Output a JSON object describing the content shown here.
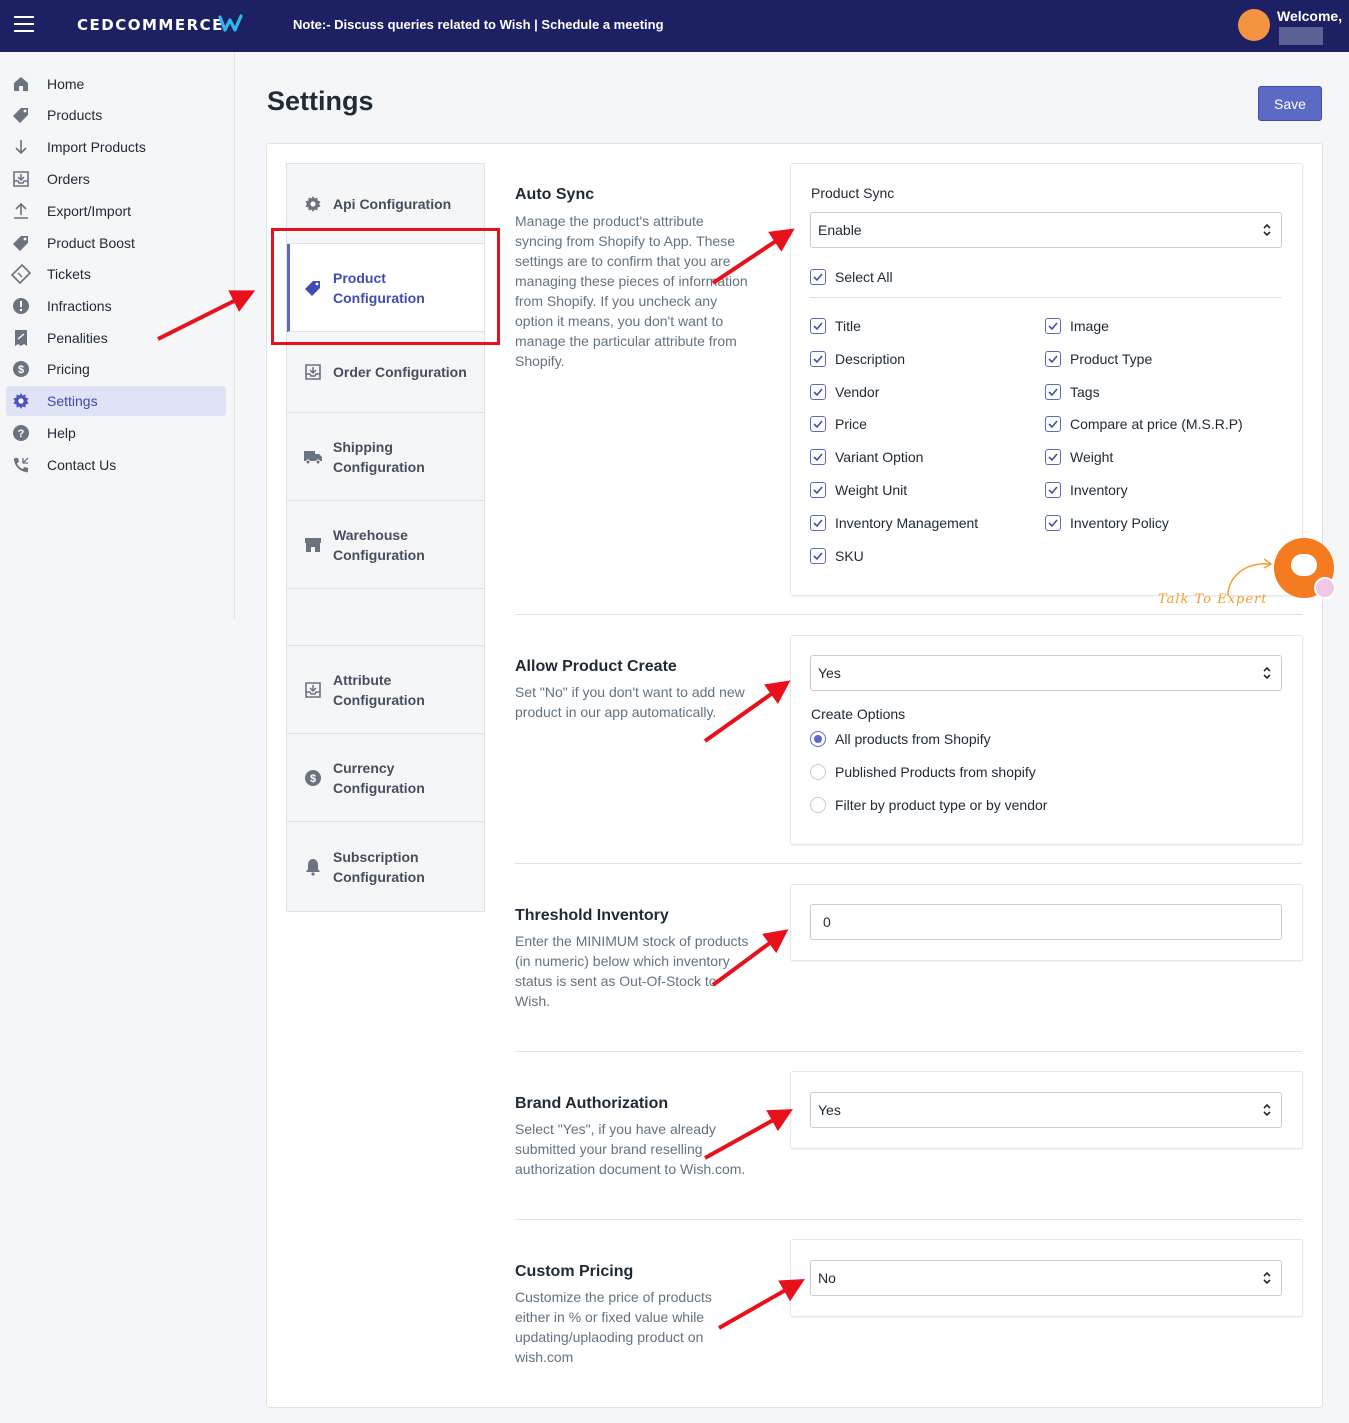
{
  "header": {
    "logo_text": "CEDCOMMERCE",
    "note_prefix": "Note:- Discuss queries related to Wish | ",
    "note_link": "Schedule a meeting",
    "welcome": "Welcome,"
  },
  "sidebar": {
    "items": [
      {
        "label": "Home",
        "icon": "home-icon"
      },
      {
        "label": "Products",
        "icon": "tag-icon"
      },
      {
        "label": "Import Products",
        "icon": "arrow-down-icon"
      },
      {
        "label": "Orders",
        "icon": "inbox-download-icon"
      },
      {
        "label": "Export/Import",
        "icon": "upload-icon"
      },
      {
        "label": "Product Boost",
        "icon": "tag-icon"
      },
      {
        "label": "Tickets",
        "icon": "ticket-icon"
      },
      {
        "label": "Infractions",
        "icon": "alert-icon"
      },
      {
        "label": "Penalities",
        "icon": "receipt-icon"
      },
      {
        "label": "Pricing",
        "icon": "dollar-icon"
      },
      {
        "label": "Settings",
        "icon": "gear-icon"
      },
      {
        "label": "Help",
        "icon": "question-icon"
      },
      {
        "label": "Contact Us",
        "icon": "phone-icon"
      }
    ],
    "active": "Settings"
  },
  "page": {
    "title": "Settings",
    "save_label": "Save"
  },
  "tabs": [
    {
      "line1": "Api Configuration",
      "line2": "",
      "icon": "gear-icon"
    },
    {
      "line1": "Product",
      "line2": "Configuration",
      "icon": "tag-icon"
    },
    {
      "line1": "Order Configuration",
      "line2": "",
      "icon": "inbox-download-icon"
    },
    {
      "line1": "Shipping",
      "line2": "Configuration",
      "icon": "truck-icon"
    },
    {
      "line1": "Warehouse",
      "line2": "Configuration",
      "icon": "store-icon"
    },
    {
      "line1": "",
      "line2": "",
      "icon": ""
    },
    {
      "line1": "Attribute",
      "line2": "Configuration",
      "icon": "inbox-download-icon"
    },
    {
      "line1": "Currency",
      "line2": "Configuration",
      "icon": "dollar-icon"
    },
    {
      "line1": "Subscription",
      "line2": "Configuration",
      "icon": "bell-icon"
    }
  ],
  "auto_sync": {
    "title": "Auto Sync",
    "desc_lines": [
      "Manage the product's attribute",
      "syncing from Shopify to App. These",
      "settings are to confirm that you are",
      "managing these pieces of information",
      "from Shopify. If you uncheck any",
      "option it means, you don't want to",
      "manage the particular attribute from",
      "Shopify."
    ],
    "field_label": "Product Sync",
    "select_value": "Enable",
    "select_all": "Select All",
    "left_options": [
      "Title",
      "Description",
      "Vendor",
      "Price",
      "Variant Option",
      "Weight Unit",
      "Inventory Management",
      "SKU"
    ],
    "right_options": [
      "Image",
      "Product Type",
      "Tags",
      "Compare at price (M.S.R.P)",
      "Weight",
      "Inventory",
      "Inventory Policy"
    ]
  },
  "allow_create": {
    "title": "Allow Product Create",
    "desc_lines": [
      "Set \"No\" if you don't want to add new",
      "product in our app automatically."
    ],
    "select_value": "Yes",
    "options_label": "Create Options",
    "options": [
      "All products from Shopify",
      "Published Products from shopify",
      "Filter by product type or by vendor"
    ],
    "selected_option": "All products from Shopify"
  },
  "threshold": {
    "title": "Threshold Inventory",
    "desc_lines": [
      "Enter the MINIMUM stock of products",
      "(in numeric) below which inventory",
      "status is sent as Out-Of-Stock to",
      "Wish."
    ],
    "value": "0"
  },
  "brand": {
    "title": "Brand Authorization",
    "desc_lines": [
      "Select \"Yes\", if you have already",
      "submitted your brand reselling",
      "authorization document to Wish.com."
    ],
    "select_value": "Yes"
  },
  "custom_pricing": {
    "title": "Custom Pricing",
    "desc_lines": [
      "Customize the price of products",
      "either in % or fixed value while",
      "updating/uplaoding product on",
      "wish.com"
    ],
    "select_value": "No"
  },
  "chat": {
    "label": "Talk To Expert"
  },
  "colors": {
    "topbar": "#1d2163",
    "accent": "#5c6ac4",
    "highlight": "#e8101b",
    "chat": "#f47b20"
  }
}
